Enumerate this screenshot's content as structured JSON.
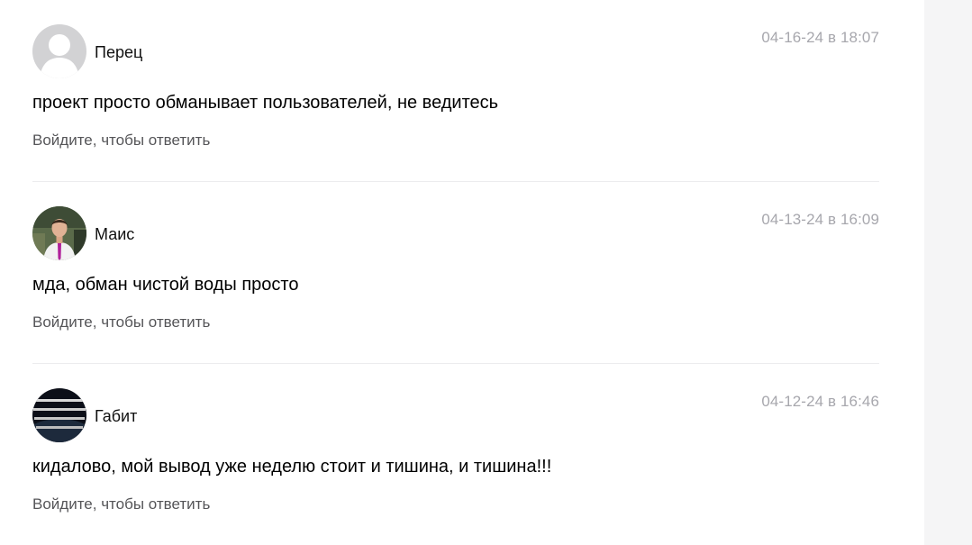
{
  "comments": [
    {
      "author": "Перец",
      "date": "04-16-24 в 18:07",
      "text": "проект просто обманывает пользователей, не ведитесь",
      "reply_label": "Войдите, чтобы ответить",
      "avatar": "default-user-avatar"
    },
    {
      "author": "Маис",
      "date": "04-13-24 в 16:09",
      "text": "мда, обман чистой воды просто",
      "reply_label": "Войдите, чтобы ответить",
      "avatar": "photo-man-in-white-shirt"
    },
    {
      "author": "Габит",
      "date": "04-12-24 в 16:46",
      "text": "кидалово, мой вывод уже неделю стоит и тишина, и тишина!!!",
      "reply_label": "Войдите, чтобы ответить",
      "avatar": "dark-image-with-text"
    }
  ],
  "colors": {
    "date": "#a7a7ad",
    "reply": "#555558",
    "divider": "#ececee",
    "rail": "#f5f5f6"
  }
}
